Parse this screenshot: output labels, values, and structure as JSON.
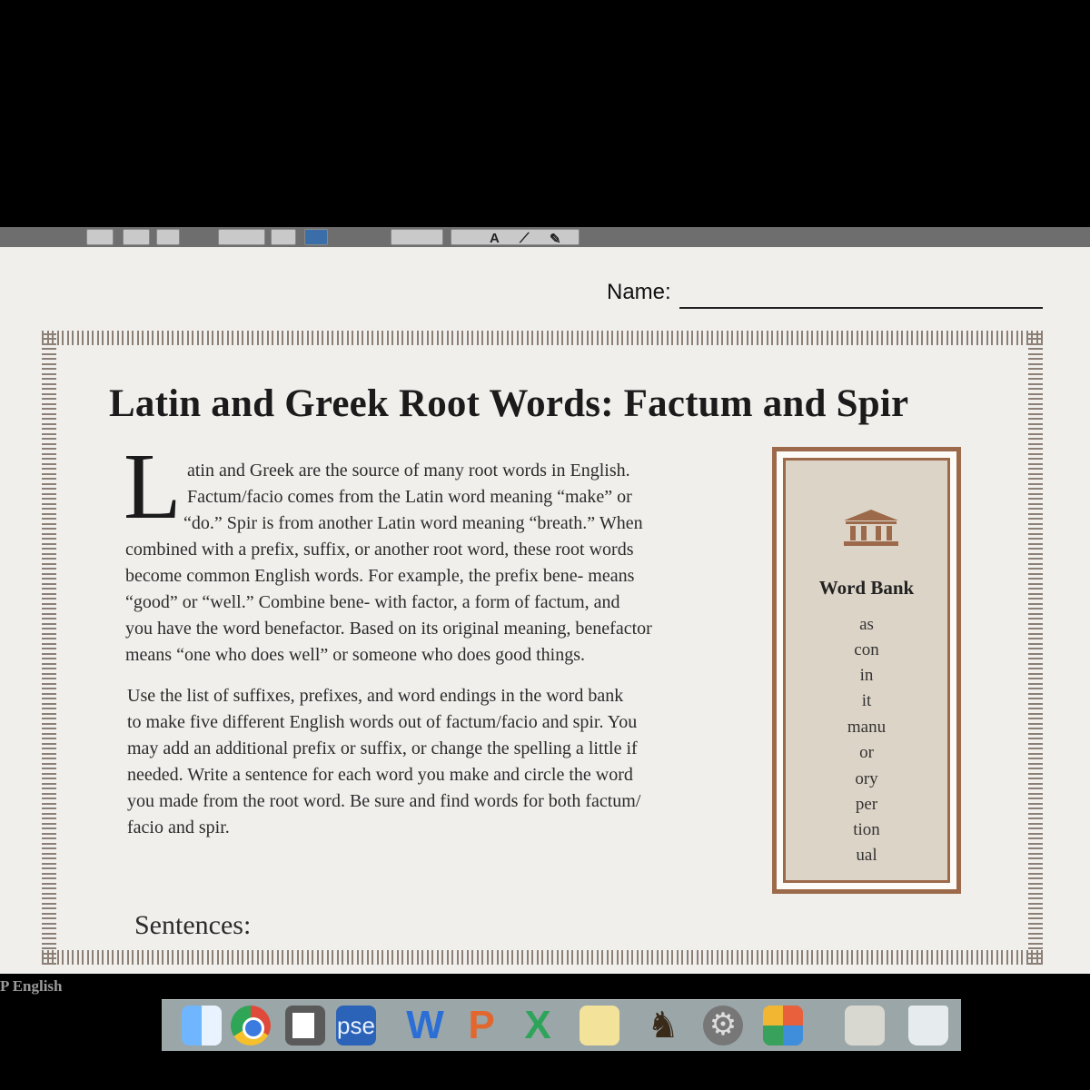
{
  "form": {
    "name_label": "Name:"
  },
  "worksheet": {
    "title": "Latin and Greek Root Words: Factum and Spir",
    "drop_cap": "L",
    "intro_lines": [
      "atin and Greek are the source of many root words in English.",
      "Factum/facio comes from the Latin word meaning “make” or",
      "“do.” Spir is from another Latin word meaning “breath.” When",
      "combined with a prefix, suffix, or another root word, these root words",
      "become common English words. For example, the prefix bene- means",
      "“good” or “well.” Combine bene- with factor, a form of factum, and",
      "you have the word benefactor. Based on its original meaning, benefactor",
      "means “one who does well” or someone who does good things."
    ],
    "instruction_lines": [
      "Use the list of suffixes, prefixes, and word endings in the word bank",
      "to make five different English words out of factum/facio and spir. You",
      "may add an additional prefix or suffix, or change the spelling a little if",
      "needed. Write a sentence for each word you make and circle the word",
      "you made from the root word. Be sure and find words for both factum/",
      "facio and spir."
    ],
    "sentences_label": "Sentences:"
  },
  "word_bank": {
    "title": "Word Bank",
    "icon": "temple-icon",
    "items": [
      "as",
      "con",
      "in",
      "it",
      "manu",
      "or",
      "ory",
      "per",
      "tion",
      "ual"
    ]
  },
  "footer": {
    "partial_label": "P English"
  },
  "dock": {
    "pages_label": "pse",
    "icons": [
      "finder-icon",
      "chrome-icon",
      "notes-icon",
      "pse-icon",
      "word-icon",
      "powerpoint-icon",
      "excel-icon",
      "stickies-icon",
      "chess-icon",
      "settings-icon",
      "office-icon",
      "scanner-icon",
      "trash-icon"
    ]
  },
  "colors": {
    "border_ornament": "#8b7f76",
    "word_bank_frame": "#9c6a4a",
    "word_bank_fill": "#ddd4c8",
    "page_bg": "#f1efec"
  }
}
